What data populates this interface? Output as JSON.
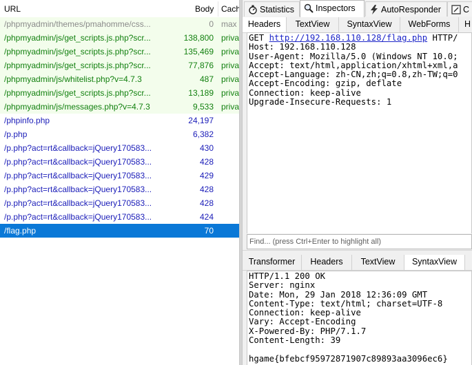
{
  "list": {
    "columns": {
      "url": "URL",
      "body": "Body",
      "cache": "Cach"
    },
    "rows": [
      {
        "url": "/phpmyadmin/themes/pmahomme/css...",
        "body": "0",
        "cache": "max",
        "style": "gray"
      },
      {
        "url": "/phpmyadmin/js/get_scripts.js.php?scr...",
        "body": "138,800",
        "cache": "priva",
        "style": "green"
      },
      {
        "url": "/phpmyadmin/js/get_scripts.js.php?scr...",
        "body": "135,469",
        "cache": "priva",
        "style": "green"
      },
      {
        "url": "/phpmyadmin/js/get_scripts.js.php?scr...",
        "body": "77,876",
        "cache": "priva",
        "style": "green"
      },
      {
        "url": "/phpmyadmin/js/whitelist.php?v=4.7.3",
        "body": "487",
        "cache": "priva",
        "style": "green"
      },
      {
        "url": "/phpmyadmin/js/get_scripts.js.php?scr...",
        "body": "13,189",
        "cache": "priva",
        "style": "green"
      },
      {
        "url": "/phpmyadmin/js/messages.php?v=4.7.3",
        "body": "9,533",
        "cache": "priva",
        "style": "green"
      },
      {
        "url": "/phpinfo.php",
        "body": "24,197",
        "cache": "",
        "style": "blue"
      },
      {
        "url": "/p.php",
        "body": "6,382",
        "cache": "",
        "style": "blue"
      },
      {
        "url": "/p.php?act=rt&callback=jQuery170583...",
        "body": "430",
        "cache": "",
        "style": "blue"
      },
      {
        "url": "/p.php?act=rt&callback=jQuery170583...",
        "body": "428",
        "cache": "",
        "style": "blue"
      },
      {
        "url": "/p.php?act=rt&callback=jQuery170583...",
        "body": "429",
        "cache": "",
        "style": "blue"
      },
      {
        "url": "/p.php?act=rt&callback=jQuery170583...",
        "body": "428",
        "cache": "",
        "style": "blue"
      },
      {
        "url": "/p.php?act=rt&callback=jQuery170583...",
        "body": "428",
        "cache": "",
        "style": "blue"
      },
      {
        "url": "/p.php?act=rt&callback=jQuery170583...",
        "body": "424",
        "cache": "",
        "style": "blue"
      },
      {
        "url": "/flag.php",
        "body": "70",
        "cache": "",
        "style": "sel"
      }
    ]
  },
  "top_tabs": [
    {
      "label": "Statistics",
      "icon": "stopwatch-icon"
    },
    {
      "label": "Inspectors",
      "icon": "magnifier-icon",
      "active": true
    },
    {
      "label": "AutoResponder",
      "icon": "lightning-icon"
    },
    {
      "label": "C",
      "icon": "composer-icon"
    }
  ],
  "request": {
    "tabs": [
      "Headers",
      "TextView",
      "SyntaxView",
      "WebForms",
      "H"
    ],
    "method": "GET ",
    "url": "http://192.168.110.128/flag.php",
    "protocol": " HTTP/",
    "headers": [
      "Host: 192.168.110.128",
      "User-Agent: Mozilla/5.0 (Windows NT 10.0; ",
      "Accept: text/html,application/xhtml+xml,a",
      "Accept-Language: zh-CN,zh;q=0.8,zh-TW;q=0",
      "Accept-Encoding: gzip, deflate",
      "Connection: keep-alive",
      "Upgrade-Insecure-Requests: 1"
    ],
    "find_placeholder": "Find... (press Ctrl+Enter to highlight all)"
  },
  "response": {
    "tabs": [
      "Transformer",
      "Headers",
      "TextView",
      "SyntaxView"
    ],
    "lines": [
      "HTTP/1.1 200 OK",
      "Server: nginx",
      "Date: Mon, 29 Jan 2018 12:36:09 GMT",
      "Content-Type: text/html; charset=UTF-8",
      "Connection: keep-alive",
      "Vary: Accept-Encoding",
      "X-Powered-By: PHP/7.1.7",
      "Content-Length: 39",
      "",
      "hgame{bfebcf95972871907c89893aa3096ec6}"
    ]
  },
  "colors": {
    "selected_row": "#0a78d7",
    "green_text": "#12800f",
    "blue_text": "#1a1cb8",
    "gray_text": "#8a8a8a",
    "green_row_bg": "#f3fdec"
  }
}
